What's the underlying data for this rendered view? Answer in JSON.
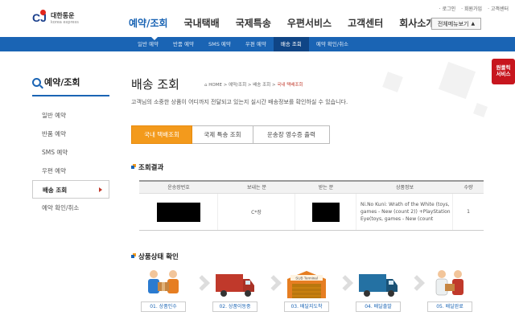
{
  "header": {
    "logo_cj": "CJ",
    "logo_korean": "대한통운",
    "logo_english": "korea express",
    "util_links": [
      "로그인",
      "회원가입",
      "고객센터"
    ],
    "main_nav": [
      {
        "label": "예약/조회",
        "active": true
      },
      {
        "label": "국내택배",
        "active": false
      },
      {
        "label": "국제특송",
        "active": false
      },
      {
        "label": "우편서비스",
        "active": false
      },
      {
        "label": "고객센터",
        "active": false
      },
      {
        "label": "회사소개",
        "active": false
      }
    ],
    "all_menu_label": "전체메뉴보기"
  },
  "sub_nav": [
    {
      "label": "일반 예약",
      "active": false
    },
    {
      "label": "반품 예약",
      "active": false
    },
    {
      "label": "SMS 예약",
      "active": false
    },
    {
      "label": "우편 예약",
      "active": false
    },
    {
      "label": "배송 조회",
      "active": true
    },
    {
      "label": "예약 확인/취소",
      "active": false
    }
  ],
  "sidebar": {
    "title": "예약/조회",
    "items": [
      {
        "label": "일반 예약",
        "active": false
      },
      {
        "label": "반품 예약",
        "active": false
      },
      {
        "label": "SMS 예약",
        "active": false
      },
      {
        "label": "우편 예약",
        "active": false
      },
      {
        "label": "배송 조회",
        "active": true
      },
      {
        "label": "예약 확인/취소",
        "active": false
      }
    ]
  },
  "main": {
    "title": "배송 조회",
    "breadcrumb": {
      "home": "HOME",
      "path": [
        "예약/조회",
        "배송 조회"
      ],
      "current": "국내 택배조회",
      "separator": ">"
    },
    "description": "고객님의 소중한 상품이 어디까지 전달되고 있는지 실시간 배송정보를 확인하실 수 있습니다.",
    "tabs": [
      {
        "label": "국내 택배조회",
        "active": true
      },
      {
        "label": "국제 특송 조회",
        "active": false
      },
      {
        "label": "운송장 영수증 출력",
        "active": false
      }
    ],
    "result_section_title": "조회결과",
    "table": {
      "headers": [
        "운송장번호",
        "보내는 분",
        "받는 분",
        "상품정보",
        "수량"
      ],
      "rows": [
        {
          "sender": "C*장",
          "product": "Ni.No Kuni: Wrath of the White (toys, games - New (count 2)) +PlayStation Eye(toys, games - New (count",
          "quantity": "1"
        }
      ]
    },
    "status_section_title": "상품상태 확인",
    "steps": [
      {
        "label": "01. 상품인수",
        "icon": "handover-icon"
      },
      {
        "label": "02. 상품이동중",
        "icon": "red-truck-icon"
      },
      {
        "label": "03. 배달지도착",
        "icon": "terminal-icon",
        "sign": "SUB Terminal"
      },
      {
        "label": "04. 배달출발",
        "icon": "blue-truck-icon"
      },
      {
        "label": "05. 배달완료",
        "icon": "delivered-icon"
      }
    ]
  },
  "one_click": {
    "label_line1": "원클릭",
    "label_line2": "서비스"
  },
  "colors": {
    "brand_blue": "#1a64b4",
    "accent_orange": "#f39a1c",
    "cj_red": "#e2261d"
  }
}
